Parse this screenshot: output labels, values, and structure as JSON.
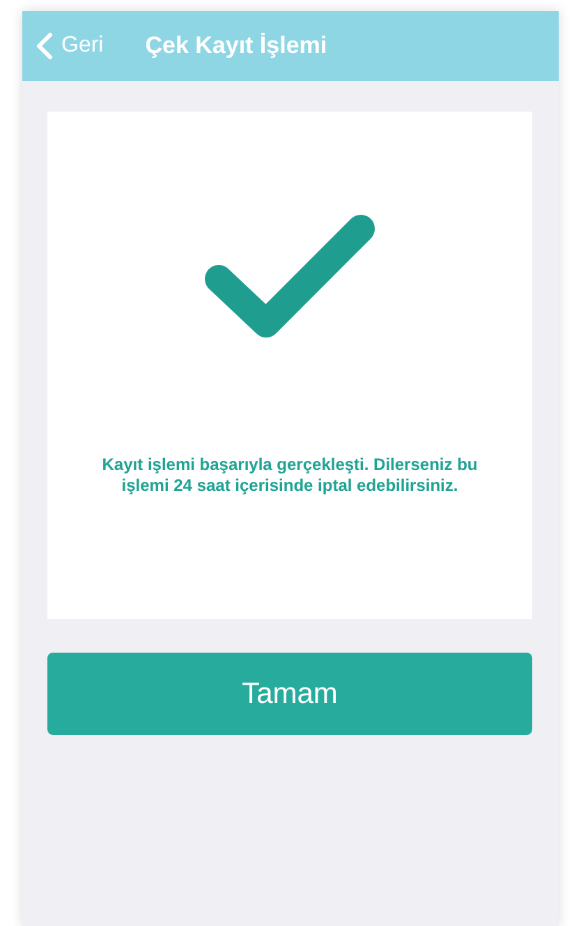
{
  "header": {
    "back_label": "Geri",
    "title": "Çek Kayıt İşlemi"
  },
  "message": "Kayıt işlemi başarıyla gerçekleşti. Dilerseniz bu işlemi 24 saat içerisinde iptal edebilirsiniz.",
  "button": {
    "label": "Tamam"
  }
}
